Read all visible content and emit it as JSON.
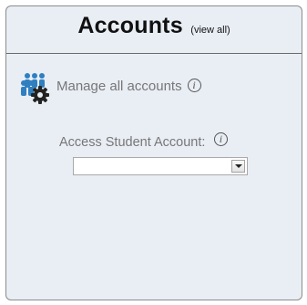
{
  "panel": {
    "title": "Accounts",
    "view_all_label": "(view all)"
  },
  "manage": {
    "icon": "people-gear-icon",
    "label": "Manage all accounts",
    "info_glyph": "i"
  },
  "student_access": {
    "label": "Access Student Account:",
    "info_glyph": "i",
    "selected_value": ""
  },
  "colors": {
    "panel_background": "#e9eef5",
    "icon_blue": "#2f7fc1",
    "icon_gear": "#222222",
    "muted_text": "#777777"
  }
}
